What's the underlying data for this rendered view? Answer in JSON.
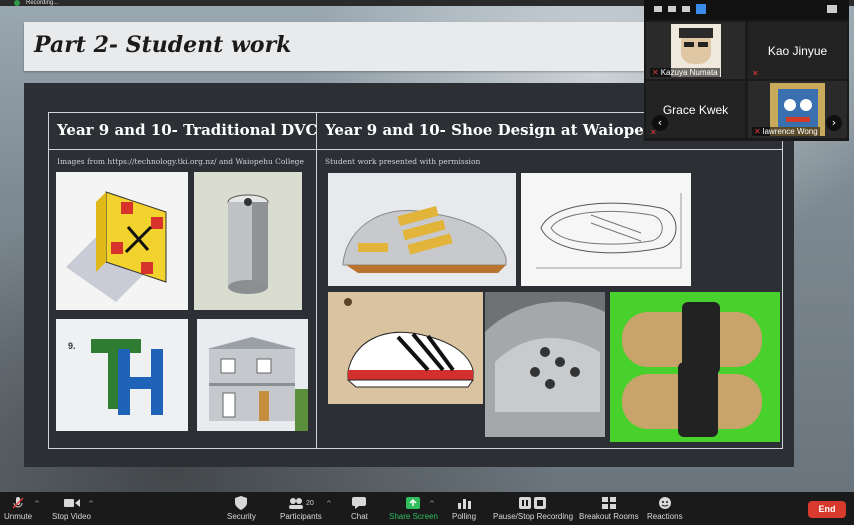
{
  "topbar": {
    "recording_label": "Recording..."
  },
  "slide": {
    "title": "Part 2- Student work",
    "left": {
      "heading": "Year 9 and 10- Traditional DVC",
      "note": "Images from https://technology.tki.org.nz/ and Waiopehu College",
      "figure_label": "9."
    },
    "right": {
      "heading": "Year 9 and 10- Shoe Design at Waiopehu",
      "note": "Student work presented with permission"
    }
  },
  "participants": {
    "tiles": [
      {
        "name": "Kazuya Numata",
        "video": true,
        "muted": true
      },
      {
        "name": "Kao Jinyue",
        "video": false,
        "muted": true
      },
      {
        "name": "Grace Kwek",
        "video": false,
        "muted": true
      },
      {
        "name": "lawrence Wong",
        "video": true,
        "muted": true
      }
    ],
    "prev_arrow": "‹",
    "next_arrow": "›"
  },
  "toolbar": {
    "unmute": "Unmute",
    "stop_video": "Stop Video",
    "security": "Security",
    "participants": "Participants",
    "participants_count": "20",
    "chat": "Chat",
    "share_screen": "Share Screen",
    "polling": "Polling",
    "pause_stop_recording": "Pause/Stop Recording",
    "breakout_rooms": "Breakout Rooms",
    "reactions": "Reactions",
    "end": "End"
  },
  "colors": {
    "accent_green": "#2fbf5d",
    "end_red": "#d83b2e",
    "slide_bg": "#2c3034"
  }
}
